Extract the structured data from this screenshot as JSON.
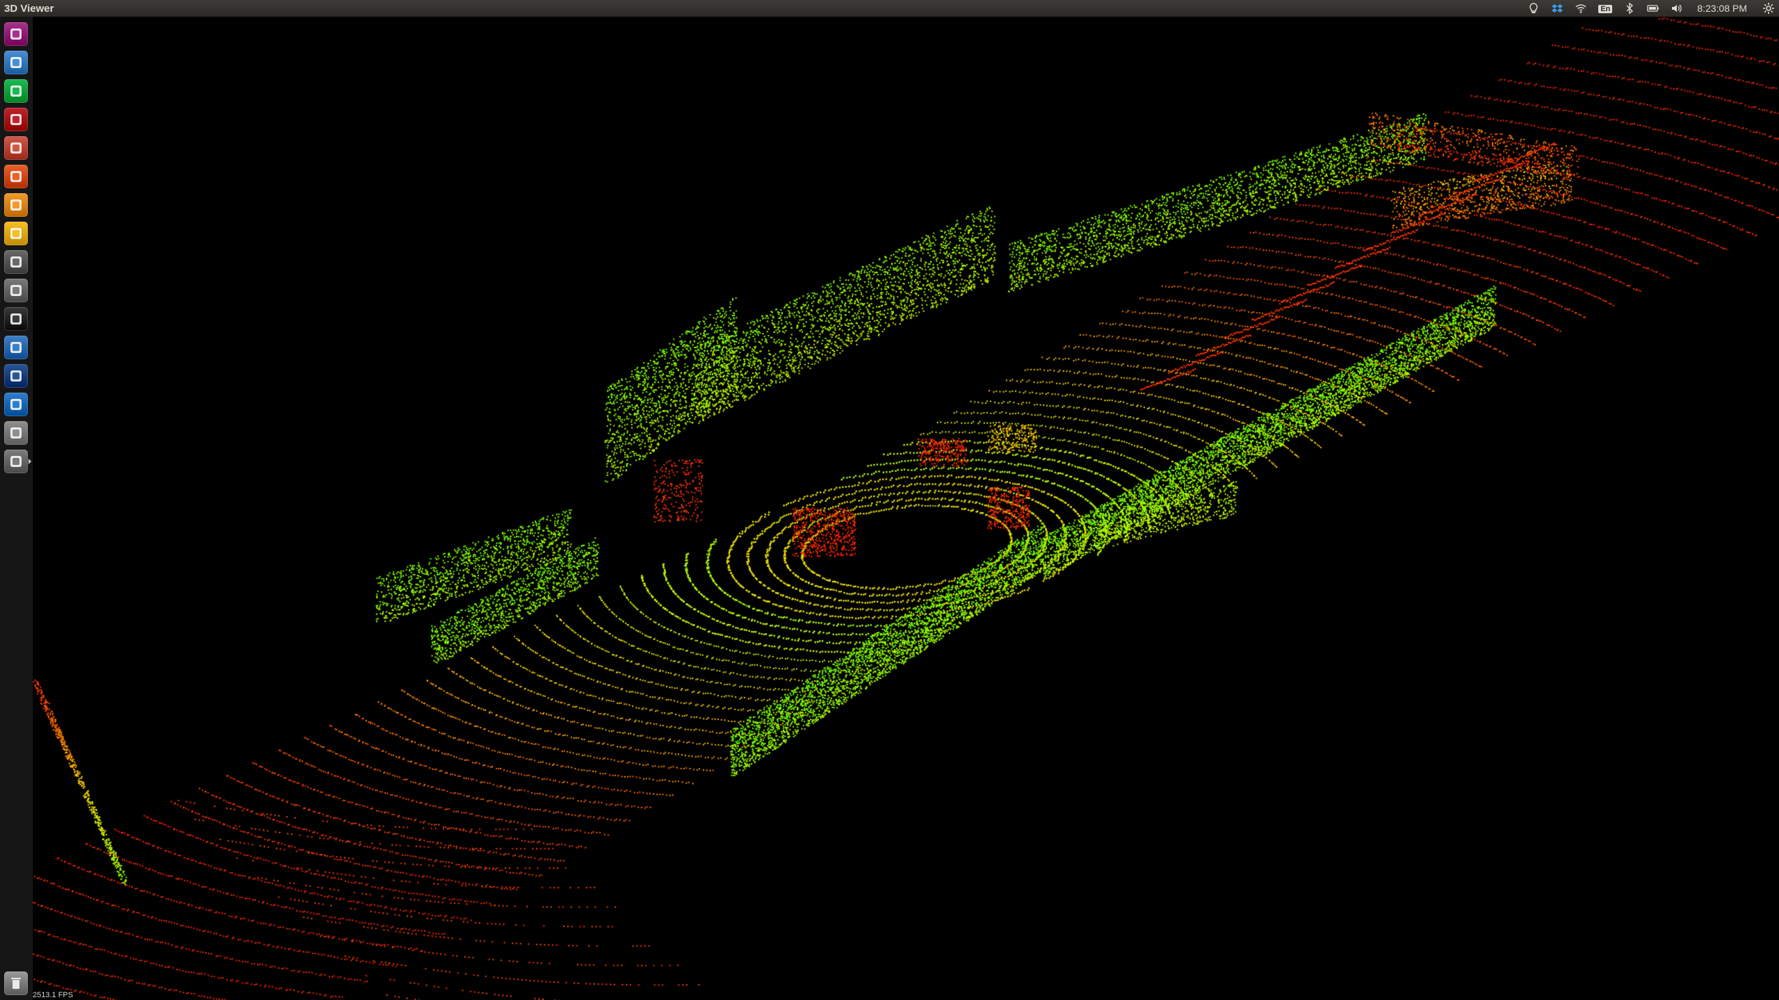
{
  "window": {
    "title": "3D Viewer"
  },
  "tray": {
    "icons": [
      "lightbulb-icon",
      "dropbox-icon",
      "wifi-icon",
      "keyboard-layout-icon",
      "bluetooth-icon",
      "battery-icon",
      "volume-icon",
      "settings-gear-icon"
    ],
    "keyboard_layout": "En",
    "clock": "8:23:08 PM"
  },
  "launcher": {
    "apps": [
      {
        "name": "ubuntu-dash-icon",
        "color": "#a8328c"
      },
      {
        "name": "chrome-icon",
        "color": "#4a8fd4"
      },
      {
        "name": "spotify-icon",
        "color": "#1db954"
      },
      {
        "name": "remote-desktop-icon",
        "color": "#c0242b"
      },
      {
        "name": "files-icon",
        "color": "#d0594a"
      },
      {
        "name": "software-center-icon",
        "color": "#e8602c"
      },
      {
        "name": "sublime-text-icon",
        "color": "#f29b2c"
      },
      {
        "name": "keep-notes-icon",
        "color": "#f6bf26"
      },
      {
        "name": "camera-icon",
        "color": "#6a6a6a"
      },
      {
        "name": "disk-icon",
        "color": "#7a7a7a"
      },
      {
        "name": "terminal-icon",
        "color": "#3a3a3a"
      },
      {
        "name": "document-viewer-icon",
        "color": "#3e7fc7"
      },
      {
        "name": "matlab-icon",
        "color": "#2a5597"
      },
      {
        "name": "vscode-icon",
        "color": "#2f7ecb"
      },
      {
        "name": "text-editor-icon",
        "color": "#8f8f8f"
      },
      {
        "name": "unknown-app-icon",
        "color": "#7c7c7c"
      }
    ],
    "trash": {
      "name": "trash-icon"
    }
  },
  "viewer": {
    "fps_label": "2513.1 FPS",
    "point_colors": [
      "#ff1a00",
      "#ff5a00",
      "#ffd000",
      "#c8ff00",
      "#66ff00"
    ]
  }
}
